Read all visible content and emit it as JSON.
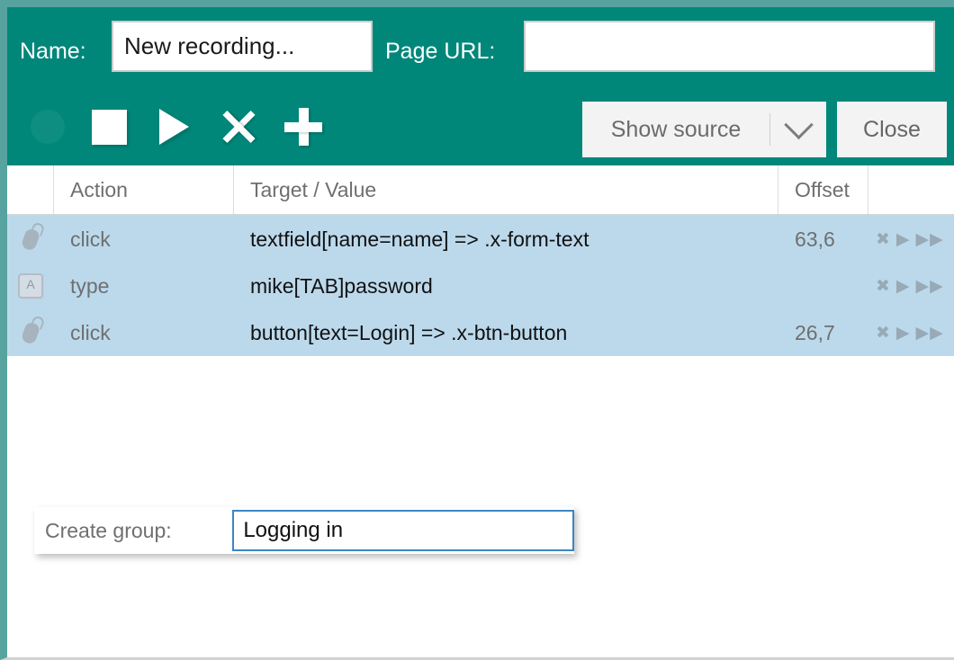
{
  "theme": {
    "accent_teal": "#00877a",
    "frame_teal": "#56a3a0",
    "row_selected_blue": "#bcd9ec",
    "focus_blue": "#3c86c4",
    "button_gray": "#f3f3f3"
  },
  "header": {
    "name_label": "Name:",
    "name_value": "New recording...",
    "name_placeholder": "New recording...",
    "url_label": "Page URL:",
    "url_value": "",
    "url_placeholder": "",
    "show_source_label": "Show source",
    "close_label": "Close",
    "toolbar": [
      {
        "name": "record-button",
        "icon": "record-circle-icon",
        "label": "Record"
      },
      {
        "name": "stop-button",
        "icon": "stop-square-icon",
        "label": "Stop"
      },
      {
        "name": "play-button",
        "icon": "play-triangle-icon",
        "label": "Play"
      },
      {
        "name": "delete-button",
        "icon": "close-x-icon",
        "label": "Delete"
      },
      {
        "name": "add-button",
        "icon": "plus-icon",
        "label": "Add"
      }
    ]
  },
  "table": {
    "columns": [
      "",
      "Action",
      "Target / Value",
      "Offset",
      ""
    ],
    "row_ops": {
      "delete": "✖",
      "play": "▶",
      "play_from_here": "▶▶"
    },
    "rows": [
      {
        "icon": "mouse-icon",
        "action": "click",
        "target": "textfield[name=name] => .x-form-text",
        "offset": "63,6"
      },
      {
        "icon": "keyboard-key-icon",
        "action": "type",
        "target": "mike[TAB]password",
        "offset": ""
      },
      {
        "icon": "mouse-icon",
        "action": "click",
        "target": "button[text=Login] => .x-btn-button",
        "offset": "26,7"
      }
    ]
  },
  "popup": {
    "label": "Create group:",
    "value": "Logging in",
    "placeholder": ""
  }
}
